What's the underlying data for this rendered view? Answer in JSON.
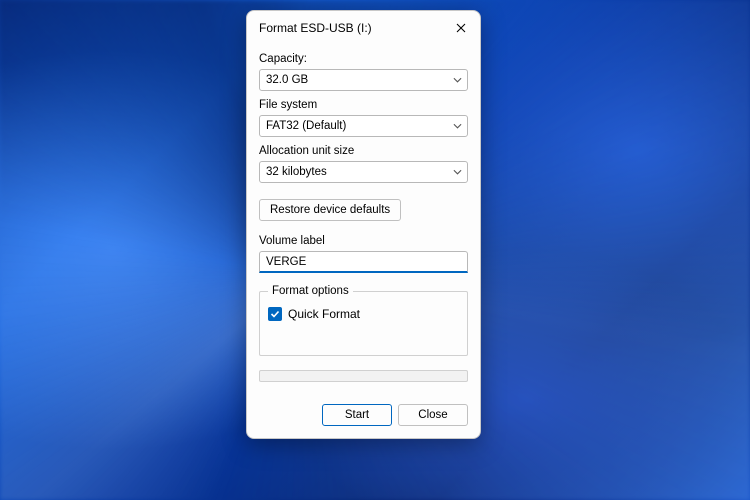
{
  "dialog": {
    "title": "Format ESD-USB (I:)",
    "capacity": {
      "label": "Capacity:",
      "value": "32.0 GB"
    },
    "filesystem": {
      "label": "File system",
      "value": "FAT32 (Default)"
    },
    "allocation": {
      "label": "Allocation unit size",
      "value": "32 kilobytes"
    },
    "restore_defaults": "Restore device defaults",
    "volume_label": {
      "label": "Volume label",
      "value": "VERGE"
    },
    "format_options": {
      "legend": "Format options",
      "quick_format": {
        "label": "Quick Format",
        "checked": true
      }
    },
    "buttons": {
      "start": "Start",
      "close": "Close"
    }
  }
}
